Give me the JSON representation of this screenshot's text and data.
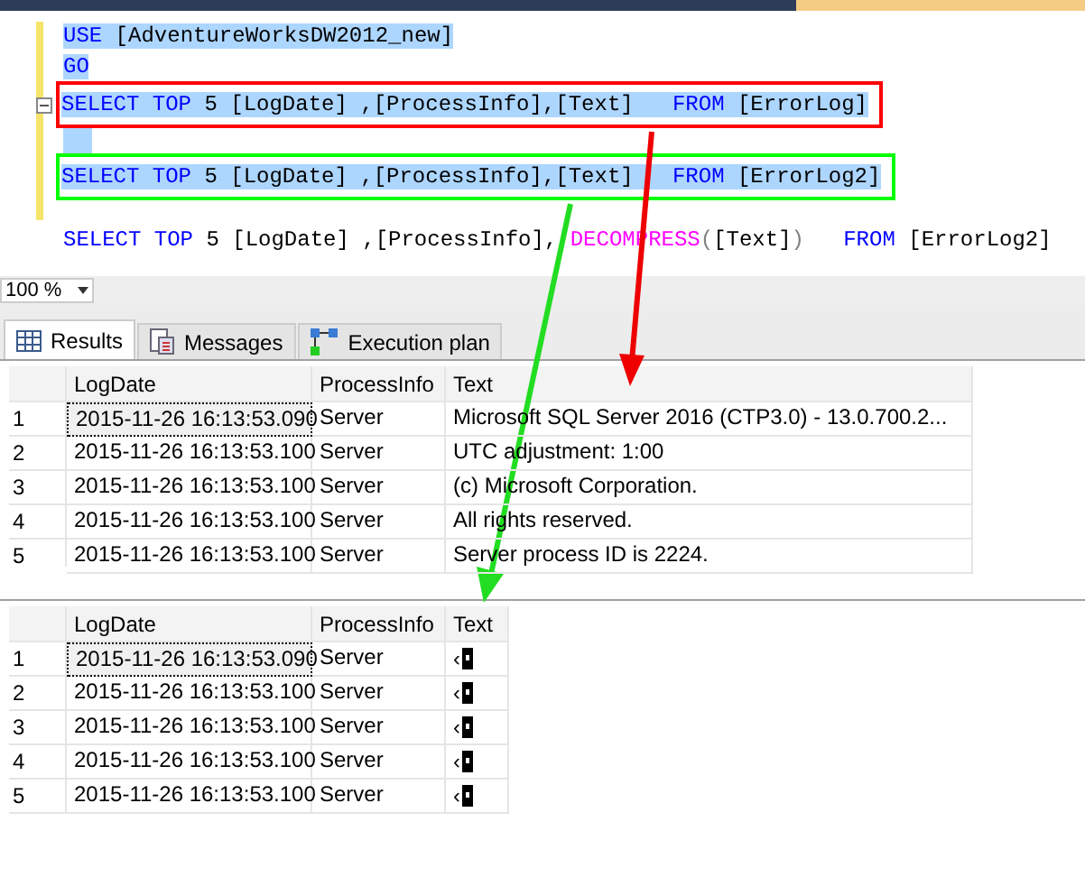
{
  "editor": {
    "lines": [
      {
        "selected": true,
        "collapsible": false,
        "tokens": [
          {
            "kind": "keyword",
            "text": "USE"
          },
          {
            "kind": "plain",
            "text": " [AdventureWorksDW2012_new]"
          }
        ]
      },
      {
        "selected": true,
        "collapsible": false,
        "tokens": [
          {
            "kind": "keyword",
            "text": "GO"
          }
        ]
      },
      {
        "selected": true,
        "collapsible": true,
        "color": "#ff0000",
        "tokens": [
          {
            "kind": "keyword",
            "text": "SELECT TOP"
          },
          {
            "kind": "plain",
            "text": " 5 [LogDate] ,[ProcessInfo],[Text]   "
          },
          {
            "kind": "keyword",
            "text": "FROM"
          },
          {
            "kind": "plain",
            "text": " [ErrorLog]"
          }
        ]
      },
      {
        "selected": true,
        "collapsible": false
      },
      {
        "selected": true,
        "collapsible": false,
        "color": "#00ff00",
        "tokens": [
          {
            "kind": "keyword",
            "text": "SELECT TOP"
          },
          {
            "kind": "plain",
            "text": " 5 [LogDate] ,[ProcessInfo],[Text]   "
          },
          {
            "kind": "keyword",
            "text": "FROM"
          },
          {
            "kind": "plain",
            "text": " [ErrorLog2]"
          }
        ]
      },
      {
        "selected": false,
        "collapsible": false,
        "tokens": [
          {
            "kind": "keyword",
            "text": "SELECT TOP"
          },
          {
            "kind": "plain",
            "text": " 5 [LogDate] ,[ProcessInfo], "
          },
          {
            "kind": "function",
            "text": "DECOMPRESS"
          },
          {
            "kind": "punct",
            "text": "("
          },
          {
            "kind": "plain",
            "text": "[Text]"
          },
          {
            "kind": "punct",
            "text": ")   "
          },
          {
            "kind": "keyword",
            "text": "FROM"
          },
          {
            "kind": "plain",
            "text": " [ErrorLog2]"
          }
        ]
      }
    ]
  },
  "zoom": {
    "value": "100 %"
  },
  "result_tabs": [
    {
      "label": "Results",
      "selected": true
    },
    {
      "label": "Messages",
      "selected": false
    },
    {
      "label": "Execution plan",
      "selected": false
    }
  ],
  "grids": [
    {
      "columns": [
        "LogDate",
        "ProcessInfo",
        "Text"
      ],
      "rows": [
        {
          "number": "1",
          "focused": true,
          "cells": [
            "2015-11-26 16:13:53.090",
            "Server",
            "Microsoft SQL Server 2016 (CTP3.0) - 13.0.700.2..."
          ]
        },
        {
          "number": "2",
          "focused": false,
          "cells": [
            "2015-11-26 16:13:53.100",
            "Server",
            "UTC adjustment: 1:00"
          ]
        },
        {
          "number": "3",
          "focused": false,
          "cells": [
            "2015-11-26 16:13:53.100",
            "Server",
            "(c) Microsoft Corporation."
          ]
        },
        {
          "number": "4",
          "focused": false,
          "cells": [
            "2015-11-26 16:13:53.100",
            "Server",
            "All rights reserved."
          ]
        },
        {
          "number": "5",
          "focused": false,
          "cells": [
            "2015-11-26 16:13:53.100",
            "Server",
            "Server process ID is 2224."
          ]
        }
      ]
    },
    {
      "columns": [
        "LogDate",
        "ProcessInfo",
        "Text"
      ],
      "rows": [
        {
          "number": "1",
          "focused": true,
          "cells": [
            "2015-11-26 16:13:53.090",
            "Server",
            "‹"
          ]
        },
        {
          "number": "2",
          "focused": false,
          "cells": [
            "2015-11-26 16:13:53.100",
            "Server",
            "‹"
          ]
        },
        {
          "number": "3",
          "focused": false,
          "cells": [
            "2015-11-26 16:13:53.100",
            "Server",
            "‹"
          ]
        },
        {
          "number": "4",
          "focused": false,
          "cells": [
            "2015-11-26 16:13:53.100",
            "Server",
            "‹"
          ]
        },
        {
          "number": "5",
          "focused": false,
          "cells": [
            "2015-11-26 16:13:53.100",
            "Server",
            "‹"
          ]
        }
      ]
    }
  ]
}
